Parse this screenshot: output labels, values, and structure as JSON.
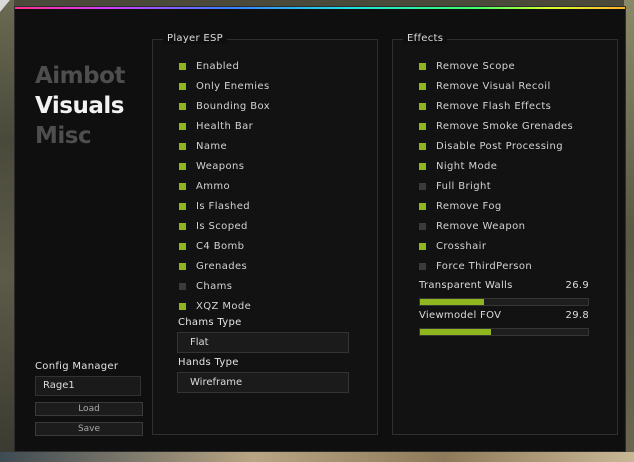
{
  "nav": {
    "items": [
      {
        "label": "Aimbot",
        "active": false
      },
      {
        "label": "Visuals",
        "active": true
      },
      {
        "label": "Misc",
        "active": false
      }
    ]
  },
  "config": {
    "title": "Config Manager",
    "name_value": "Rage1",
    "load_label": "Load",
    "save_label": "Save"
  },
  "player_esp": {
    "title": "Player ESP",
    "options": [
      {
        "label": "Enabled",
        "checked": true
      },
      {
        "label": "Only Enemies",
        "checked": true
      },
      {
        "label": "Bounding Box",
        "checked": true
      },
      {
        "label": "Health Bar",
        "checked": true
      },
      {
        "label": "Name",
        "checked": true
      },
      {
        "label": "Weapons",
        "checked": true
      },
      {
        "label": "Ammo",
        "checked": true
      },
      {
        "label": "Is Flashed",
        "checked": true
      },
      {
        "label": "Is Scoped",
        "checked": true
      },
      {
        "label": "C4 Bomb",
        "checked": true
      },
      {
        "label": "Grenades",
        "checked": true
      },
      {
        "label": "Chams",
        "checked": false
      },
      {
        "label": "XQZ Mode",
        "checked": true
      }
    ],
    "chams_type_label": "Chams Type",
    "chams_type_value": "Flat",
    "hands_type_label": "Hands Type",
    "hands_type_value": "Wireframe"
  },
  "effects": {
    "title": "Effects",
    "options": [
      {
        "label": "Remove Scope",
        "checked": true
      },
      {
        "label": "Remove Visual Recoil",
        "checked": true
      },
      {
        "label": "Remove Flash Effects",
        "checked": true
      },
      {
        "label": "Remove Smoke Grenades",
        "checked": true
      },
      {
        "label": "Disable Post Processing",
        "checked": true
      },
      {
        "label": "Night Mode",
        "checked": true
      },
      {
        "label": "Full Bright",
        "checked": false
      },
      {
        "label": "Remove Fog",
        "checked": true
      },
      {
        "label": "Remove Weapon",
        "checked": false
      },
      {
        "label": "Crosshair",
        "checked": true
      },
      {
        "label": "Force ThirdPerson",
        "checked": false
      }
    ],
    "sliders": [
      {
        "label": "Transparent Walls",
        "value": "26.9",
        "fill_fraction": 0.38
      },
      {
        "label": "Viewmodel FOV",
        "value": "29.8",
        "fill_fraction": 0.42
      }
    ]
  },
  "colors": {
    "accent": "#8fb51f",
    "checkbox_off": "#3b3b3b",
    "background": "#0f0f0f"
  }
}
